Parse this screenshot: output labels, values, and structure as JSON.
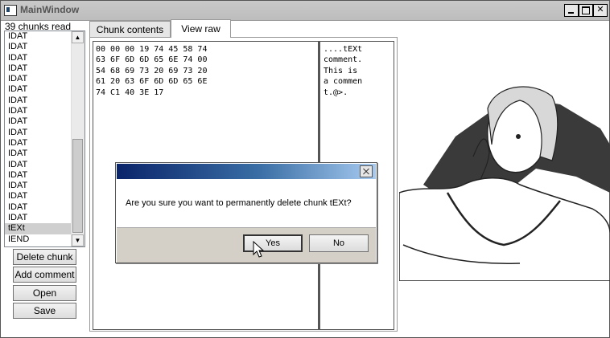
{
  "window": {
    "title": "MainWindow"
  },
  "chunk_list": {
    "count_label": "39 chunks read",
    "items": [
      "IDAT",
      "IDAT",
      "IDAT",
      "IDAT",
      "IDAT",
      "IDAT",
      "IDAT",
      "IDAT",
      "IDAT",
      "IDAT",
      "IDAT",
      "IDAT",
      "IDAT",
      "IDAT",
      "IDAT",
      "IDAT",
      "IDAT",
      "IDAT",
      "tEXt",
      "IEND"
    ],
    "selected_index": 18
  },
  "buttons": {
    "delete": "Delete chunk",
    "add_comment": "Add comment",
    "open": "Open",
    "save": "Save"
  },
  "tabs": [
    {
      "label": "Chunk contents",
      "active": false
    },
    {
      "label": "View raw",
      "active": true
    }
  ],
  "raw_view": {
    "hex_lines": [
      "00 00 00 19 74 45 58 74",
      "63 6F 6D 6D 65 6E 74 00",
      "54 68 69 73 20 69 73 20",
      "61 20 63 6F 6D 6D 65 6E",
      "74 C1 40 3E 17"
    ],
    "ascii_lines": [
      "....tEXt",
      "comment.",
      "This is ",
      "a commen",
      "t.@>."
    ]
  },
  "dialog": {
    "message": "Are you sure you want to permanently delete chunk tEXt?",
    "yes_label": "Yes",
    "no_label": "No"
  },
  "icons": [
    "app-icon",
    "minimize-icon",
    "maximize-icon",
    "close-icon",
    "scroll-up-icon",
    "scroll-down-icon",
    "dialog-close-icon",
    "mouse-cursor-icon"
  ]
}
